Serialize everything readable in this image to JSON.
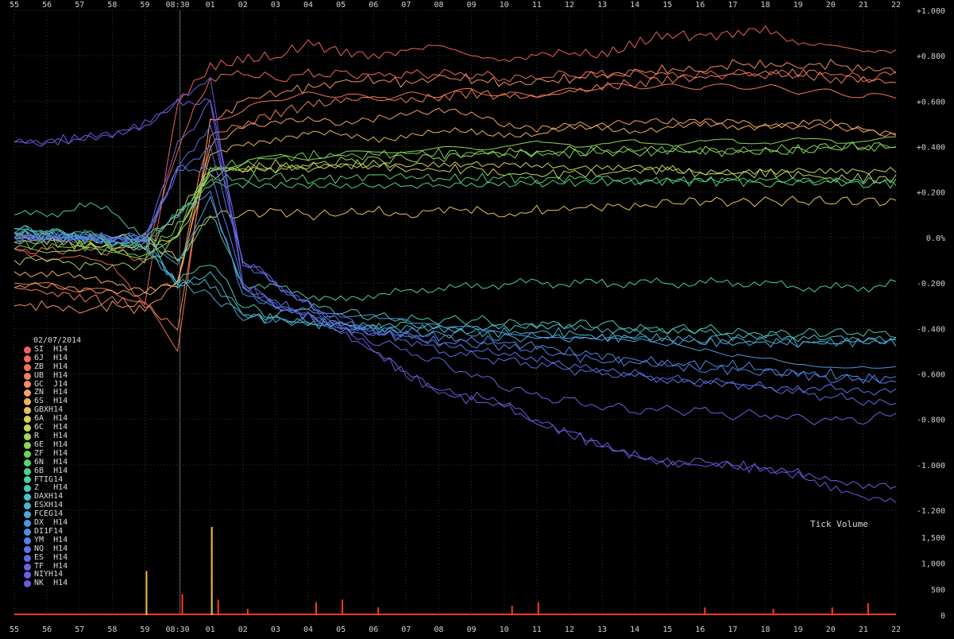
{
  "chart_data": {
    "type": "line",
    "date": "02/07/2014",
    "x_ticks": [
      "55",
      "56",
      "57",
      "58",
      "59",
      "08:30",
      "01",
      "02",
      "03",
      "04",
      "05",
      "06",
      "07",
      "08",
      "09",
      "10",
      "11",
      "12",
      "13",
      "14",
      "15",
      "16",
      "17",
      "18",
      "19",
      "20",
      "21",
      "22"
    ],
    "y_ticks": [
      "+1.000",
      "+0.800",
      "+0.600",
      "+0.400",
      "+0.200",
      "0.0%",
      "-0.200",
      "-0.400",
      "-0.600",
      "-0.800",
      "-1.000",
      "-1.200"
    ],
    "ylim": [
      -1.2,
      1.0
    ],
    "volume_label": "Tick Volume",
    "volume_ticks": [
      "1,500",
      "1,000",
      "500",
      "0"
    ],
    "volume_ylim": [
      0,
      1500
    ],
    "grid": true,
    "legend_position": "bottom-left",
    "event_line_x": "08:30",
    "series": [
      {
        "name": "SI  H14",
        "color": "#f0605a",
        "values": [
          -0.05,
          -0.1,
          -0.08,
          -0.12,
          -0.3,
          0.6,
          0.75,
          0.78,
          0.8,
          0.85,
          0.82,
          0.8,
          0.82,
          0.85,
          0.8,
          0.78,
          0.8,
          0.82,
          0.8,
          0.85,
          0.9,
          0.88,
          0.9,
          0.92,
          0.85,
          0.85,
          0.82,
          0.82
        ]
      },
      {
        "name": "6J  H14",
        "color": "#f16a55",
        "values": [
          -0.05,
          -0.06,
          -0.05,
          -0.06,
          -0.1,
          0.4,
          0.7,
          0.72,
          0.7,
          0.72,
          0.72,
          0.72,
          0.72,
          0.72,
          0.72,
          0.7,
          0.7,
          0.72,
          0.72,
          0.72,
          0.72,
          0.72,
          0.72,
          0.72,
          0.72,
          0.72,
          0.7,
          0.72
        ]
      },
      {
        "name": "ZB  H14",
        "color": "#f07456",
        "values": [
          -0.2,
          -0.22,
          -0.24,
          -0.25,
          -0.3,
          -0.5,
          0.5,
          0.55,
          0.6,
          0.62,
          0.62,
          0.6,
          0.62,
          0.62,
          0.64,
          0.62,
          0.62,
          0.64,
          0.66,
          0.66,
          0.66,
          0.66,
          0.66,
          0.66,
          0.64,
          0.64,
          0.62,
          0.62
        ]
      },
      {
        "name": "UB  H14",
        "color": "#f2805a",
        "values": [
          -0.22,
          -0.24,
          -0.26,
          -0.28,
          -0.3,
          -0.4,
          0.45,
          0.5,
          0.55,
          0.58,
          0.6,
          0.62,
          0.6,
          0.62,
          0.64,
          0.62,
          0.62,
          0.64,
          0.66,
          0.68,
          0.7,
          0.7,
          0.72,
          0.72,
          0.72,
          0.7,
          0.7,
          0.68
        ]
      },
      {
        "name": "GC  J14",
        "color": "#f39060",
        "values": [
          -0.3,
          -0.3,
          -0.32,
          -0.3,
          -0.32,
          -0.2,
          0.5,
          0.6,
          0.64,
          0.66,
          0.68,
          0.7,
          0.68,
          0.7,
          0.7,
          0.68,
          0.68,
          0.7,
          0.72,
          0.72,
          0.74,
          0.74,
          0.76,
          0.76,
          0.76,
          0.76,
          0.74,
          0.74
        ]
      },
      {
        "name": "ZN  H14",
        "color": "#f4a062",
        "values": [
          -0.22,
          -0.22,
          -0.24,
          -0.25,
          -0.26,
          -0.2,
          0.4,
          0.48,
          0.5,
          0.52,
          0.5,
          0.52,
          0.54,
          0.56,
          0.55,
          0.5,
          0.48,
          0.5,
          0.5,
          0.52,
          0.52,
          0.52,
          0.52,
          0.5,
          0.5,
          0.5,
          0.48,
          0.46
        ]
      },
      {
        "name": "6S  H14",
        "color": "#f2b05c",
        "values": [
          -0.15,
          -0.16,
          -0.18,
          -0.2,
          -0.22,
          -0.2,
          0.35,
          0.42,
          0.44,
          0.45,
          0.45,
          0.44,
          0.45,
          0.46,
          0.46,
          0.46,
          0.46,
          0.47,
          0.48,
          0.48,
          0.48,
          0.49,
          0.49,
          0.5,
          0.5,
          0.5,
          0.48,
          0.47
        ]
      },
      {
        "name": "GBXH14",
        "color": "#e6c45a",
        "values": [
          0.0,
          0.0,
          -0.02,
          0.0,
          0.0,
          -0.1,
          0.1,
          0.1,
          0.12,
          0.1,
          0.1,
          0.12,
          0.1,
          0.12,
          0.12,
          0.1,
          0.12,
          0.12,
          0.14,
          0.14,
          0.15,
          0.16,
          0.16,
          0.16,
          0.16,
          0.16,
          0.16,
          0.16
        ]
      },
      {
        "name": "6A  H14",
        "color": "#d6d25a",
        "values": [
          0.0,
          -0.02,
          -0.04,
          -0.05,
          -0.05,
          0.0,
          0.3,
          0.3,
          0.3,
          0.32,
          0.32,
          0.32,
          0.33,
          0.33,
          0.33,
          0.33,
          0.33,
          0.32,
          0.32,
          0.32,
          0.31,
          0.3,
          0.3,
          0.3,
          0.3,
          0.3,
          0.3,
          0.3
        ]
      },
      {
        "name": "6C  H14",
        "color": "#c2d658",
        "values": [
          -0.02,
          -0.02,
          -0.03,
          -0.04,
          -0.04,
          0.1,
          0.3,
          0.3,
          0.32,
          0.3,
          0.32,
          0.32,
          0.3,
          0.3,
          0.3,
          0.28,
          0.28,
          0.28,
          0.28,
          0.3,
          0.3,
          0.28,
          0.28,
          0.28,
          0.28,
          0.26,
          0.26,
          0.26
        ]
      },
      {
        "name": "R   H14",
        "color": "#a8d656",
        "values": [
          -0.1,
          -0.1,
          -0.12,
          -0.12,
          -0.12,
          0.0,
          0.28,
          0.3,
          0.3,
          0.32,
          0.34,
          0.34,
          0.35,
          0.35,
          0.36,
          0.38,
          0.38,
          0.38,
          0.38,
          0.38,
          0.38,
          0.38,
          0.38,
          0.38,
          0.38,
          0.4,
          0.4,
          0.4
        ]
      },
      {
        "name": "6E  H14",
        "color": "#8cd654",
        "values": [
          -0.05,
          -0.06,
          -0.06,
          -0.07,
          -0.08,
          0.0,
          0.3,
          0.34,
          0.36,
          0.36,
          0.38,
          0.38,
          0.4,
          0.4,
          0.4,
          0.42,
          0.42,
          0.42,
          0.42,
          0.42,
          0.42,
          0.42,
          0.42,
          0.42,
          0.42,
          0.42,
          0.42,
          0.42
        ]
      },
      {
        "name": "ZF  H14",
        "color": "#6ed654",
        "values": [
          -0.02,
          -0.04,
          -0.04,
          -0.06,
          -0.08,
          0.05,
          0.3,
          0.33,
          0.35,
          0.36,
          0.36,
          0.36,
          0.37,
          0.37,
          0.37,
          0.37,
          0.37,
          0.37,
          0.38,
          0.38,
          0.38,
          0.38,
          0.38,
          0.39,
          0.39,
          0.4,
          0.4,
          0.4
        ]
      },
      {
        "name": "6N  H14",
        "color": "#56d470",
        "values": [
          0.02,
          0.0,
          0.0,
          -0.02,
          -0.02,
          0.1,
          0.26,
          0.26,
          0.26,
          0.26,
          0.26,
          0.27,
          0.27,
          0.26,
          0.26,
          0.26,
          0.26,
          0.26,
          0.26,
          0.25,
          0.25,
          0.25,
          0.25,
          0.24,
          0.24,
          0.24,
          0.24,
          0.24
        ]
      },
      {
        "name": "6B  H14",
        "color": "#4ed28a",
        "values": [
          0.02,
          0.02,
          0.02,
          0.0,
          0.0,
          0.1,
          0.24,
          0.24,
          0.24,
          0.24,
          0.24,
          0.24,
          0.24,
          0.24,
          0.24,
          0.24,
          0.24,
          0.24,
          0.24,
          0.24,
          0.24,
          0.24,
          0.24,
          0.24,
          0.24,
          0.24,
          0.24,
          0.24
        ]
      },
      {
        "name": "FTIG14",
        "color": "#48d0a2",
        "values": [
          0.1,
          0.1,
          0.14,
          0.12,
          0.0,
          -0.1,
          0.1,
          -0.2,
          -0.22,
          -0.25,
          -0.28,
          -0.25,
          -0.24,
          -0.22,
          -0.22,
          -0.2,
          -0.2,
          -0.2,
          -0.2,
          -0.2,
          -0.2,
          -0.2,
          -0.2,
          -0.2,
          -0.22,
          -0.22,
          -0.22,
          -0.2
        ]
      },
      {
        "name": "Z   H14",
        "color": "#46cab6",
        "values": [
          0.04,
          0.02,
          0.02,
          0.0,
          0.0,
          -0.2,
          -0.1,
          -0.3,
          -0.35,
          -0.3,
          -0.32,
          -0.35,
          -0.36,
          -0.36,
          -0.36,
          -0.38,
          -0.38,
          -0.38,
          -0.38,
          -0.4,
          -0.4,
          -0.4,
          -0.42,
          -0.42,
          -0.42,
          -0.42,
          -0.42,
          -0.42
        ]
      },
      {
        "name": "DAXH14",
        "color": "#46c2c8",
        "values": [
          0.04,
          0.02,
          0.0,
          -0.02,
          -0.04,
          -0.2,
          -0.15,
          -0.32,
          -0.35,
          -0.36,
          -0.38,
          -0.38,
          -0.38,
          -0.4,
          -0.4,
          -0.4,
          -0.4,
          -0.4,
          -0.42,
          -0.42,
          -0.42,
          -0.42,
          -0.44,
          -0.44,
          -0.44,
          -0.44,
          -0.44,
          -0.44
        ]
      },
      {
        "name": "ESXH14",
        "color": "#48b6d2",
        "values": [
          0.02,
          0.0,
          0.0,
          -0.02,
          -0.04,
          -0.2,
          -0.2,
          -0.34,
          -0.36,
          -0.38,
          -0.38,
          -0.4,
          -0.4,
          -0.4,
          -0.42,
          -0.42,
          -0.42,
          -0.42,
          -0.44,
          -0.44,
          -0.44,
          -0.46,
          -0.46,
          -0.46,
          -0.46,
          -0.46,
          -0.46,
          -0.46
        ]
      },
      {
        "name": "FCEG14",
        "color": "#4aa8d8",
        "values": [
          0.02,
          0.0,
          0.0,
          -0.02,
          -0.02,
          -0.2,
          -0.25,
          -0.35,
          -0.36,
          -0.38,
          -0.4,
          -0.4,
          -0.42,
          -0.42,
          -0.42,
          -0.44,
          -0.44,
          -0.44,
          -0.44,
          -0.44,
          -0.45,
          -0.45,
          -0.45,
          -0.46,
          -0.46,
          -0.46,
          -0.46,
          -0.45
        ]
      },
      {
        "name": "DX  H14",
        "color": "#4c9ade",
        "values": [
          0.02,
          0.02,
          0.0,
          0.0,
          0.0,
          -0.1,
          0.2,
          -0.2,
          -0.3,
          -0.32,
          -0.35,
          -0.36,
          -0.38,
          -0.4,
          -0.4,
          -0.42,
          -0.44,
          -0.44,
          -0.45,
          -0.46,
          -0.48,
          -0.5,
          -0.52,
          -0.52,
          -0.54,
          -0.55,
          -0.55,
          -0.56
        ]
      },
      {
        "name": "DI1F14",
        "color": "#4e8ce2",
        "values": [
          0.0,
          0.0,
          0.0,
          -0.02,
          -0.02,
          0.1,
          0.2,
          -0.25,
          -0.3,
          -0.34,
          -0.38,
          -0.4,
          -0.42,
          -0.44,
          -0.45,
          -0.46,
          -0.48,
          -0.5,
          -0.52,
          -0.54,
          -0.55,
          -0.56,
          -0.56,
          -0.58,
          -0.6,
          -0.6,
          -0.62,
          -0.62
        ]
      },
      {
        "name": "YM  H14",
        "color": "#5480e4",
        "values": [
          0.0,
          0.0,
          0.0,
          0.0,
          0.0,
          0.3,
          0.3,
          -0.2,
          -0.28,
          -0.35,
          -0.4,
          -0.42,
          -0.44,
          -0.46,
          -0.46,
          -0.48,
          -0.5,
          -0.52,
          -0.54,
          -0.55,
          -0.56,
          -0.58,
          -0.58,
          -0.6,
          -0.6,
          -0.62,
          -0.62,
          -0.64
        ]
      },
      {
        "name": "NQ  H14",
        "color": "#5a76e6",
        "values": [
          0.0,
          0.0,
          0.0,
          0.0,
          0.0,
          0.3,
          0.4,
          -0.1,
          -0.2,
          -0.3,
          -0.38,
          -0.42,
          -0.44,
          -0.48,
          -0.5,
          -0.52,
          -0.54,
          -0.56,
          -0.58,
          -0.6,
          -0.62,
          -0.62,
          -0.64,
          -0.65,
          -0.66,
          -0.66,
          -0.68,
          -0.68
        ]
      },
      {
        "name": "ES  H14",
        "color": "#606ce6",
        "values": [
          0.0,
          0.0,
          0.0,
          0.0,
          0.0,
          0.3,
          0.5,
          -0.1,
          -0.2,
          -0.3,
          -0.35,
          -0.42,
          -0.45,
          -0.5,
          -0.52,
          -0.54,
          -0.56,
          -0.58,
          -0.6,
          -0.6,
          -0.62,
          -0.64,
          -0.64,
          -0.66,
          -0.68,
          -0.7,
          -0.72,
          -0.74
        ]
      },
      {
        "name": "TF  H14",
        "color": "#6864e4",
        "values": [
          0.0,
          0.0,
          0.0,
          0.0,
          0.0,
          0.4,
          0.6,
          -0.1,
          -0.2,
          -0.3,
          -0.4,
          -0.45,
          -0.5,
          -0.55,
          -0.6,
          -0.65,
          -0.7,
          -0.72,
          -0.74,
          -0.76,
          -0.76,
          -0.76,
          -0.78,
          -0.78,
          -0.8,
          -0.8,
          -0.8,
          -0.78
        ]
      },
      {
        "name": "NIYH14",
        "color": "#6e5ee0",
        "values": [
          0.42,
          0.42,
          0.44,
          0.46,
          0.5,
          0.6,
          0.6,
          -0.2,
          -0.3,
          -0.35,
          -0.4,
          -0.5,
          -0.6,
          -0.68,
          -0.7,
          -0.72,
          -0.8,
          -0.85,
          -0.9,
          -0.95,
          -0.98,
          -0.98,
          -1.0,
          -1.02,
          -1.04,
          -1.08,
          -1.1,
          -1.1
        ]
      },
      {
        "name": "NK  H14",
        "color": "#6a5adc",
        "values": [
          0.42,
          0.42,
          0.44,
          0.46,
          0.5,
          0.6,
          0.7,
          -0.2,
          -0.3,
          -0.35,
          -0.42,
          -0.5,
          -0.6,
          -0.68,
          -0.72,
          -0.74,
          -0.82,
          -0.86,
          -0.92,
          -0.96,
          -1.0,
          -1.0,
          -1.0,
          -1.02,
          -1.05,
          -1.1,
          -1.14,
          -1.16
        ]
      }
    ],
    "volume_spikes": [
      {
        "x": "59",
        "value": 850,
        "color": "#f2c040"
      },
      {
        "x": "08:30",
        "value": 400,
        "color": "#ff3a1a"
      },
      {
        "x": "01",
        "value": 300,
        "color": "#ff3a1a"
      },
      {
        "x": "01",
        "value": 1700,
        "color": "#f2c040"
      },
      {
        "x": "02",
        "value": 120,
        "color": "#ff3a1a"
      },
      {
        "x": "04",
        "value": 250,
        "color": "#ff3a1a"
      },
      {
        "x": "05",
        "value": 300,
        "color": "#ff3a1a"
      },
      {
        "x": "06",
        "value": 150,
        "color": "#ff3a1a"
      },
      {
        "x": "10",
        "value": 180,
        "color": "#ff3a1a"
      },
      {
        "x": "11",
        "value": 250,
        "color": "#ff3a1a"
      },
      {
        "x": "16",
        "value": 150,
        "color": "#ff3a1a"
      },
      {
        "x": "18",
        "value": 120,
        "color": "#ff3a1a"
      },
      {
        "x": "20",
        "value": 150,
        "color": "#ff3a1a"
      },
      {
        "x": "21",
        "value": 230,
        "color": "#ff3a1a"
      }
    ]
  }
}
